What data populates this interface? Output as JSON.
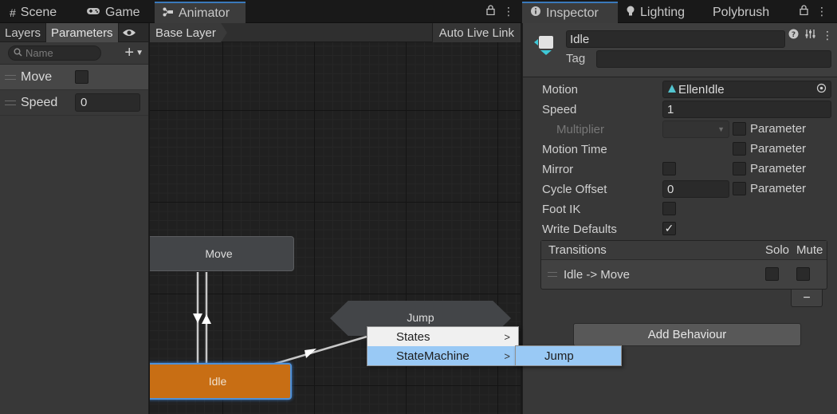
{
  "left_tabs": {
    "scene": {
      "label": "Scene",
      "icon": "grid-icon"
    },
    "game": {
      "label": "Game",
      "icon": "gamepad-icon"
    },
    "animator": {
      "label": "Animator",
      "icon": "animator-icon"
    }
  },
  "right_tabs": {
    "inspector": {
      "label": "Inspector",
      "icon": "info-icon"
    },
    "lighting": {
      "label": "Lighting",
      "icon": "bulb-icon"
    },
    "polybrush": {
      "label": "Polybrush"
    }
  },
  "params_panel": {
    "layers_tab": "Layers",
    "parameters_tab": "Parameters",
    "search_placeholder": "Name",
    "params": [
      {
        "name": "Move",
        "type": "bool",
        "value": false
      },
      {
        "name": "Speed",
        "type": "float",
        "value": "0"
      }
    ]
  },
  "graph": {
    "breadcrumb": "Base Layer",
    "auto_live_link": "Auto Live Link",
    "states": {
      "move": "Move",
      "idle": "Idle",
      "jump": "Jump"
    },
    "colors": {
      "default_state": "#434548",
      "entry_state": "#c86e14",
      "selection": "#4f91d8"
    }
  },
  "context_menu": {
    "items": [
      {
        "label": "States",
        "submenu": true,
        "highlighted": false
      },
      {
        "label": "StateMachine",
        "submenu": true,
        "highlighted": true
      }
    ],
    "submenu_items": [
      {
        "label": "Jump",
        "highlighted": true
      }
    ]
  },
  "inspector": {
    "name": "Idle",
    "tag_label": "Tag",
    "tag_value": "",
    "properties": {
      "motion_label": "Motion",
      "motion_value": "EllenIdle",
      "speed_label": "Speed",
      "speed_value": "1",
      "multiplier_label": "Multiplier",
      "motion_time_label": "Motion Time",
      "mirror_label": "Mirror",
      "cycle_offset_label": "Cycle Offset",
      "cycle_offset_value": "0",
      "foot_ik_label": "Foot IK",
      "write_defaults_label": "Write Defaults",
      "parameter_label": "Parameter",
      "write_defaults_checked": true
    },
    "transitions": {
      "header": "Transitions",
      "solo_label": "Solo",
      "mute_label": "Mute",
      "rows": [
        {
          "name": "Idle -> Move",
          "solo": false,
          "mute": false
        }
      ],
      "remove_label": "−"
    },
    "add_behaviour": "Add Behaviour"
  }
}
